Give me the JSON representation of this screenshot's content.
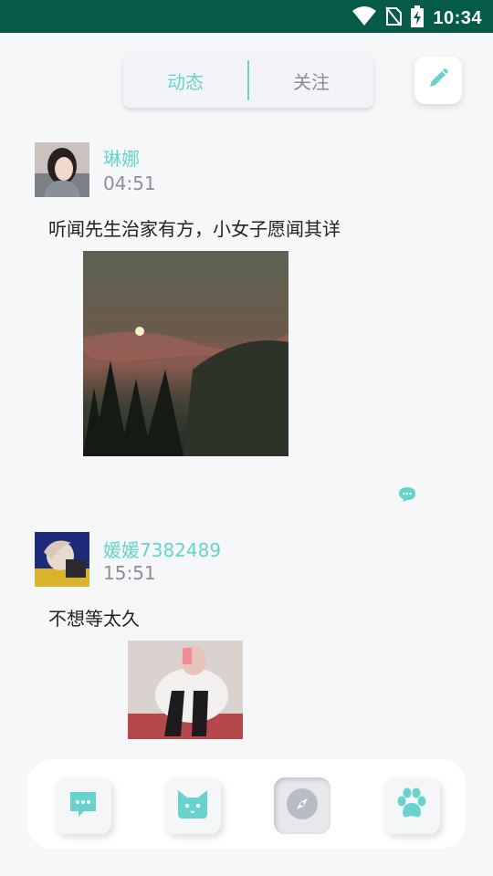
{
  "status_bar": {
    "time": "10:34"
  },
  "header": {
    "tabs": [
      {
        "label": "动态",
        "active": true
      },
      {
        "label": "关注",
        "active": false
      }
    ],
    "edit_icon": "pencil-icon"
  },
  "posts": [
    {
      "username": "琳娜",
      "time": "04:51",
      "text": "听闻先生治家有方，小女子愿闻其详",
      "image": "dusk-sky-photo"
    },
    {
      "username": "媛媛7382489",
      "time": "15:51",
      "text": "不想等太久",
      "image": "girl-photo"
    }
  ],
  "bottom_nav": [
    {
      "icon": "message-icon"
    },
    {
      "icon": "cat-icon"
    },
    {
      "icon": "compass-icon"
    },
    {
      "icon": "paw-icon"
    }
  ],
  "colors": {
    "accent": "#67d3cc",
    "statusbar": "#065a48",
    "background": "#f6f7f9"
  }
}
